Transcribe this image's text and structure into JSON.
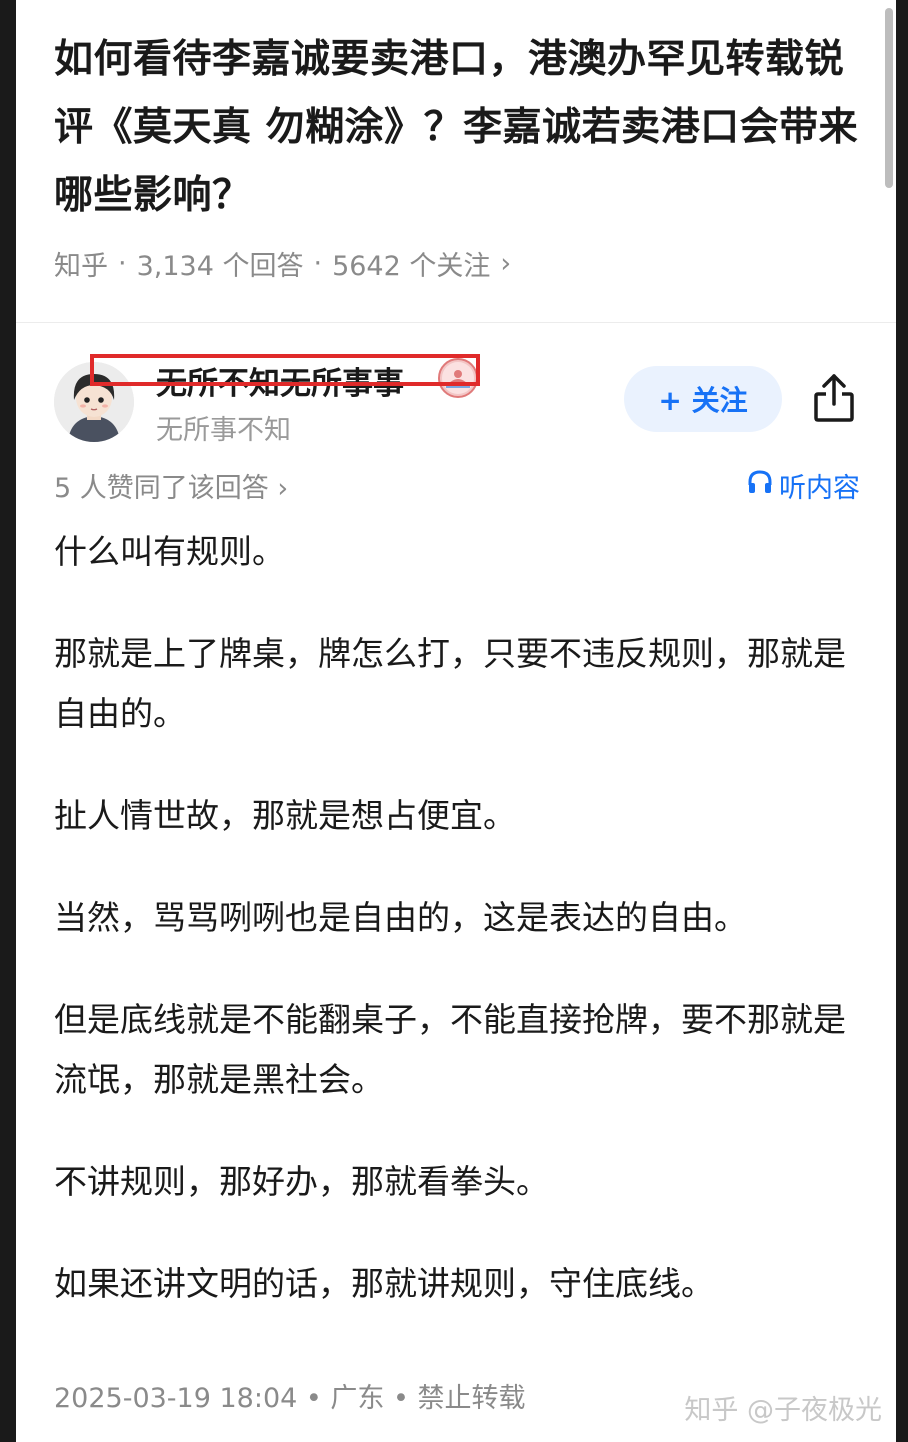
{
  "question": {
    "title": "如何看待李嘉诚要卖港口，港澳办罕见转载锐评《莫天真 勿糊涂》？李嘉诚若卖港口会带来哪些影响？",
    "source": "知乎",
    "answers": "3,134 个回答",
    "followers": "5642 个关注",
    "meta_sep": "·",
    "chevron": "›"
  },
  "author": {
    "name": "无所不知无所事事",
    "bio": "无所事不知",
    "follow_label": "+ 关注"
  },
  "answer": {
    "votes": "5 人赞同了该回答 ›",
    "listen_label": "听内容",
    "paragraphs": [
      "什么叫有规则。",
      "那就是上了牌桌，牌怎么打，只要不违反规则，那就是自由的。",
      "扯人情世故，那就是想占便宜。",
      "当然，骂骂咧咧也是自由的，这是表达的自由。",
      "但是底线就是不能翻桌子，不能直接抢牌，要不那就是流氓，那就是黑社会。",
      "不讲规则，那好办，那就看拳头。",
      "如果还讲文明的话，那就讲规则，守住底线。"
    ],
    "footer": "2025-03-19 18:04 • 广东 • 禁止转载"
  },
  "watermark": "知乎 @子夜极光",
  "colors": {
    "accent": "#1772f6",
    "highlight_box": "#e02a2a",
    "text": "#1a1a1a",
    "muted": "#8a8a8a"
  },
  "icons": [
    "headphones-icon",
    "share-icon",
    "chevron-right-icon",
    "badge-icon"
  ]
}
